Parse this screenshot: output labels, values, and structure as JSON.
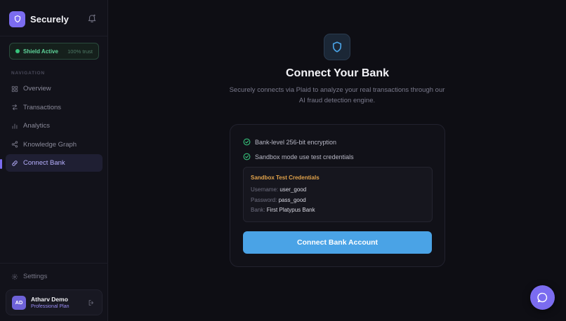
{
  "app": {
    "name": "Securely",
    "colors": {
      "accent": "#7b6cf0",
      "success": "#36c47c",
      "primary_button": "#4aa3e6",
      "warning": "#e1a24a"
    }
  },
  "sidebar": {
    "shield": {
      "label": "Shield Active",
      "trust": "100% trust"
    },
    "nav_heading": "NAVIGATION",
    "items": [
      {
        "label": "Overview",
        "icon": "grid-icon"
      },
      {
        "label": "Transactions",
        "icon": "arrows-icon"
      },
      {
        "label": "Analytics",
        "icon": "bar-chart-icon"
      },
      {
        "label": "Knowledge Graph",
        "icon": "share-nodes-icon"
      },
      {
        "label": "Connect Bank",
        "icon": "link-icon",
        "active": true
      }
    ],
    "settings_label": "Settings",
    "user": {
      "initials": "AD",
      "name": "Atharv Demo",
      "plan": "Professional Plan"
    }
  },
  "main": {
    "title": "Connect Your Bank",
    "subtitle": "Securely connects via Plaid to analyze your real transactions through our AI fraud detection engine.",
    "features": [
      "Bank-level 256-bit encryption",
      "Sandbox mode use test credentials"
    ],
    "credentials": {
      "title": "Sandbox Test Credentials",
      "username_label": "Username:",
      "username": "user_good",
      "password_label": "Password:",
      "password": "pass_good",
      "bank_label": "Bank:",
      "bank": "First Platypus Bank"
    },
    "connect_button": "Connect Bank Account"
  }
}
